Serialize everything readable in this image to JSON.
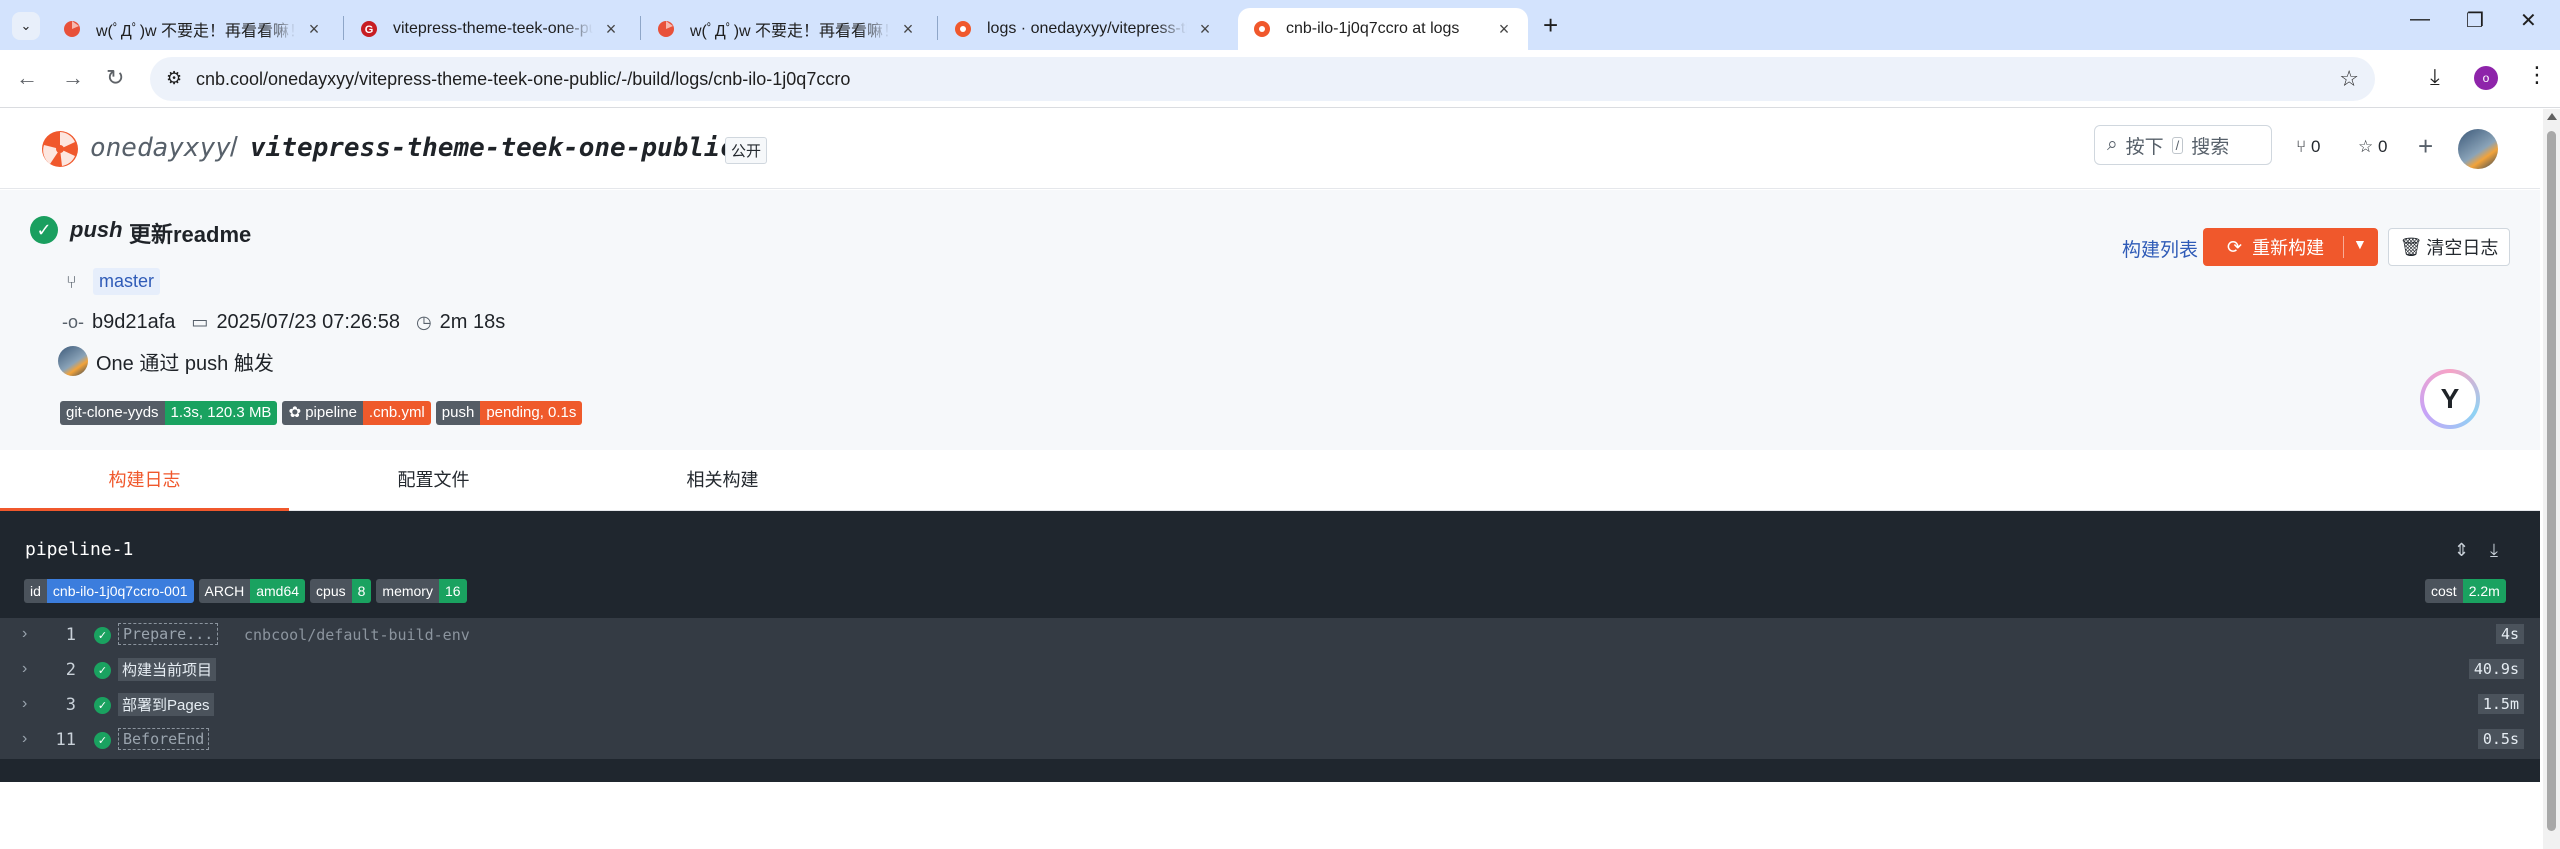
{
  "browser": {
    "tabs": [
      {
        "title": "w(ﾟДﾟ)w 不要走！再看看嘛！",
        "favicon": "fan-logo-icon",
        "active": false
      },
      {
        "title": "vitepress-theme-teek-one-public",
        "favicon": "gitee-logo-icon",
        "active": false
      },
      {
        "title": "w(ﾟДﾟ)w 不要走！再看看嘛！",
        "favicon": "fan-logo-icon",
        "active": false
      },
      {
        "title": "logs · onedayxyy/vitepress-theme-teek-one-public",
        "favicon": "cnb-logo-icon",
        "active": false
      },
      {
        "title": "cnb-ilo-1j0q7ccro at logs",
        "favicon": "cnb-logo-icon",
        "active": true
      }
    ],
    "url": "cnb.cool/onedayxyy/vitepress-theme-teek-one-public/-/build/logs/cnb-ilo-1j0q7ccro",
    "profile_initial": "o"
  },
  "repo": {
    "owner": "onedayxyy",
    "separator": "/",
    "name": "vitepress-theme-teek-one-public",
    "visibility": "公开"
  },
  "topnav": {
    "search_prefix": "按下",
    "search_key": "/",
    "search_suffix": "搜索",
    "fork_count": "0",
    "star_count": "0"
  },
  "build": {
    "event": "push",
    "commit_title": "更新readme",
    "branch": "master",
    "commit_sha": "b9d21afa",
    "datetime": "2025/07/23 07:26:58",
    "duration": "2m 18s",
    "trigger_text": "One 通过 push 触发",
    "badges": [
      {
        "key": "git-clone-yyds",
        "value": "1.3s, 120.3 MB",
        "color": "#1aa260"
      },
      {
        "key": "pipeline",
        "value": ".cnb.yml",
        "color": "#ef5a2b"
      },
      {
        "key": "push",
        "value": "pending, 0.1s",
        "color": "#ef5a2b"
      }
    ],
    "actions": {
      "build_list": "构建列表",
      "rebuild": "重新构建",
      "clear_log": "清空日志"
    }
  },
  "page_tabs": [
    {
      "label": "构建日志",
      "active": true
    },
    {
      "label": "配置文件",
      "active": false
    },
    {
      "label": "相关构建",
      "active": false
    }
  ],
  "log": {
    "pipeline_name": "pipeline-1",
    "env": [
      {
        "key": "id",
        "value": "cnb-ilo-1j0q7ccro-001",
        "color": "#3b7ddd"
      },
      {
        "key": "ARCH",
        "value": "amd64",
        "color": "#1aa260"
      },
      {
        "key": "cpus",
        "value": "8",
        "color": "#1aa260"
      },
      {
        "key": "memory",
        "value": "16",
        "color": "#1aa260"
      }
    ],
    "cost": {
      "key": "cost",
      "value": "2.2m",
      "color": "#1aa260"
    },
    "steps": [
      {
        "num": "1",
        "name": "Prepare...",
        "style": "dashed",
        "desc": "cnbcool/default-build-env",
        "duration": "4s"
      },
      {
        "num": "2",
        "name": "构建当前项目",
        "style": "solid",
        "desc": "",
        "duration": "40.9s"
      },
      {
        "num": "3",
        "name": "部署到Pages",
        "style": "solid",
        "desc": "",
        "duration": "1.5m"
      },
      {
        "num": "11",
        "name": "BeforeEnd",
        "style": "dashed",
        "desc": "",
        "duration": "0.5s"
      }
    ]
  },
  "colors": {
    "accent": "#f0582c",
    "success": "#1aa260",
    "link": "#2f5bb7",
    "log_bg": "#1f262e"
  }
}
